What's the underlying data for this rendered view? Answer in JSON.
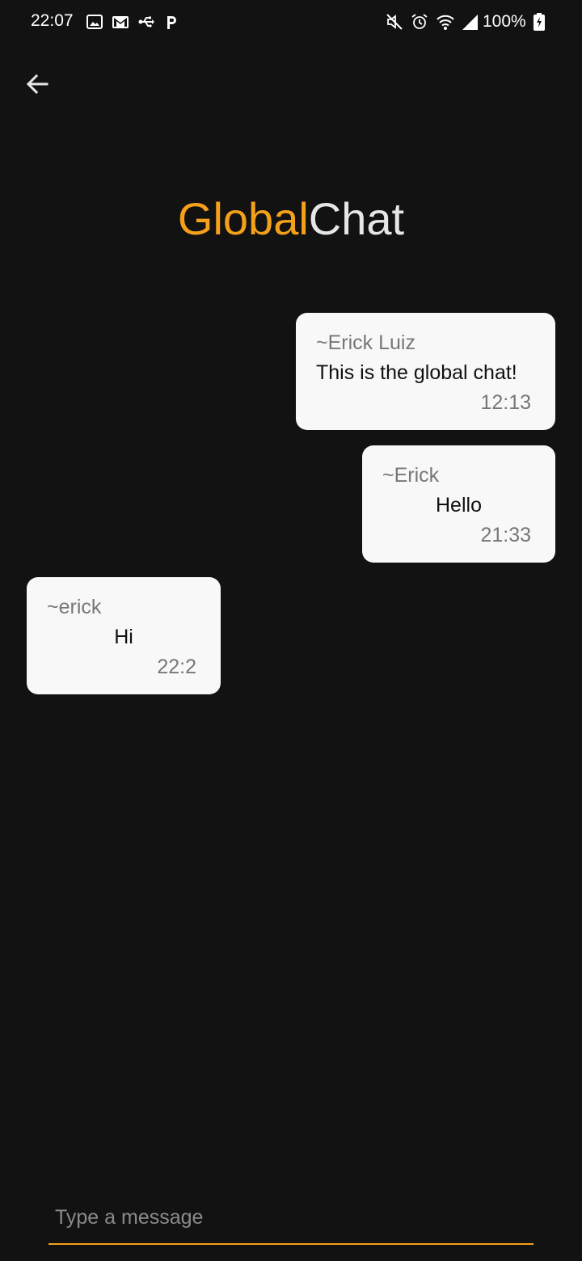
{
  "status_bar": {
    "time": "22:07",
    "battery": "100%",
    "left_icons": [
      "image-icon",
      "gmail-icon",
      "usb-icon",
      "parking-icon"
    ],
    "right_icons": [
      "mute-icon",
      "alarm-icon",
      "wifi-icon",
      "signal-icon",
      "battery-icon"
    ]
  },
  "header": {
    "back_icon": "arrow-left-icon"
  },
  "title": {
    "accent": "Global",
    "rest": "Chat",
    "accent_color": "#f5a01a",
    "rest_color": "#e6e6e6"
  },
  "messages": [
    {
      "sender": "~Erick Luiz",
      "text": "This is the global chat!",
      "time": "12:13"
    },
    {
      "sender": "~Erick",
      "text": "Hello",
      "time": "21:33"
    },
    {
      "sender": "~erick",
      "text": "Hi",
      "time": "22:2"
    }
  ],
  "composer": {
    "placeholder": "Type a message",
    "value": "",
    "accent_color": "#f5a01a"
  },
  "colors": {
    "background": "#121212",
    "bubble": "#f8f8f8"
  }
}
